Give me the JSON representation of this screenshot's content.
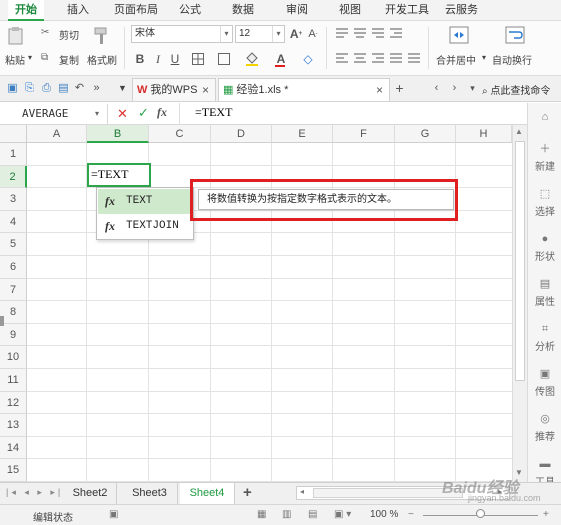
{
  "menu": {
    "tabs": [
      "开始",
      "插入",
      "页面布局",
      "公式",
      "数据",
      "审阅",
      "视图",
      "开发工具",
      "云服务"
    ],
    "active": 0
  },
  "ribbon": {
    "paste_label": "粘贴",
    "cut_label": "剪切",
    "copy_label": "复制",
    "format_painter_label": "格式刷",
    "font_name": "宋体",
    "font_size": "12",
    "merge_center_label": "合并居中",
    "wrap_text_label": "自动换行"
  },
  "doctabs": {
    "wps_label": "我的WPS",
    "file_label": "经验1.xls *",
    "search_label": "点此查找命令"
  },
  "formula_bar": {
    "name_box": "AVERAGE",
    "cancel": "✕",
    "confirm": "✓",
    "fx": "fx",
    "content": "=TEXT"
  },
  "grid": {
    "columns": [
      "A",
      "B",
      "C",
      "D",
      "E",
      "F",
      "G",
      "H"
    ],
    "rows": [
      "1",
      "2",
      "3",
      "4",
      "5",
      "6",
      "7",
      "8",
      "9",
      "10",
      "11",
      "12",
      "13",
      "14",
      "15"
    ],
    "selected_column": "B",
    "selected_row": "2",
    "active_cell_text": "=TEXT"
  },
  "autocomplete": {
    "items": [
      {
        "icon": "fx",
        "label": "TEXT"
      },
      {
        "icon": "fx",
        "label": "TEXTJOIN"
      }
    ],
    "tooltip": "将数值转换为按指定数字格式表示的文本。"
  },
  "right_panel": {
    "items": [
      "新建",
      "选择",
      "形状",
      "属性",
      "分析",
      "传图",
      "推荐",
      "工具"
    ]
  },
  "sheets": {
    "tabs": [
      "Sheet2",
      "Sheet3",
      "Sheet4"
    ],
    "active": "Sheet4",
    "add_label": "+"
  },
  "status": {
    "mode": "编辑状态",
    "zoom": "100 %"
  },
  "watermark": {
    "text": "Baidu经验",
    "sub": "jingyan.baidu.com"
  },
  "colors": {
    "accent": "#2ca54b",
    "highlight_box": "#e02020",
    "selection_fill": "#cfe9cc"
  }
}
